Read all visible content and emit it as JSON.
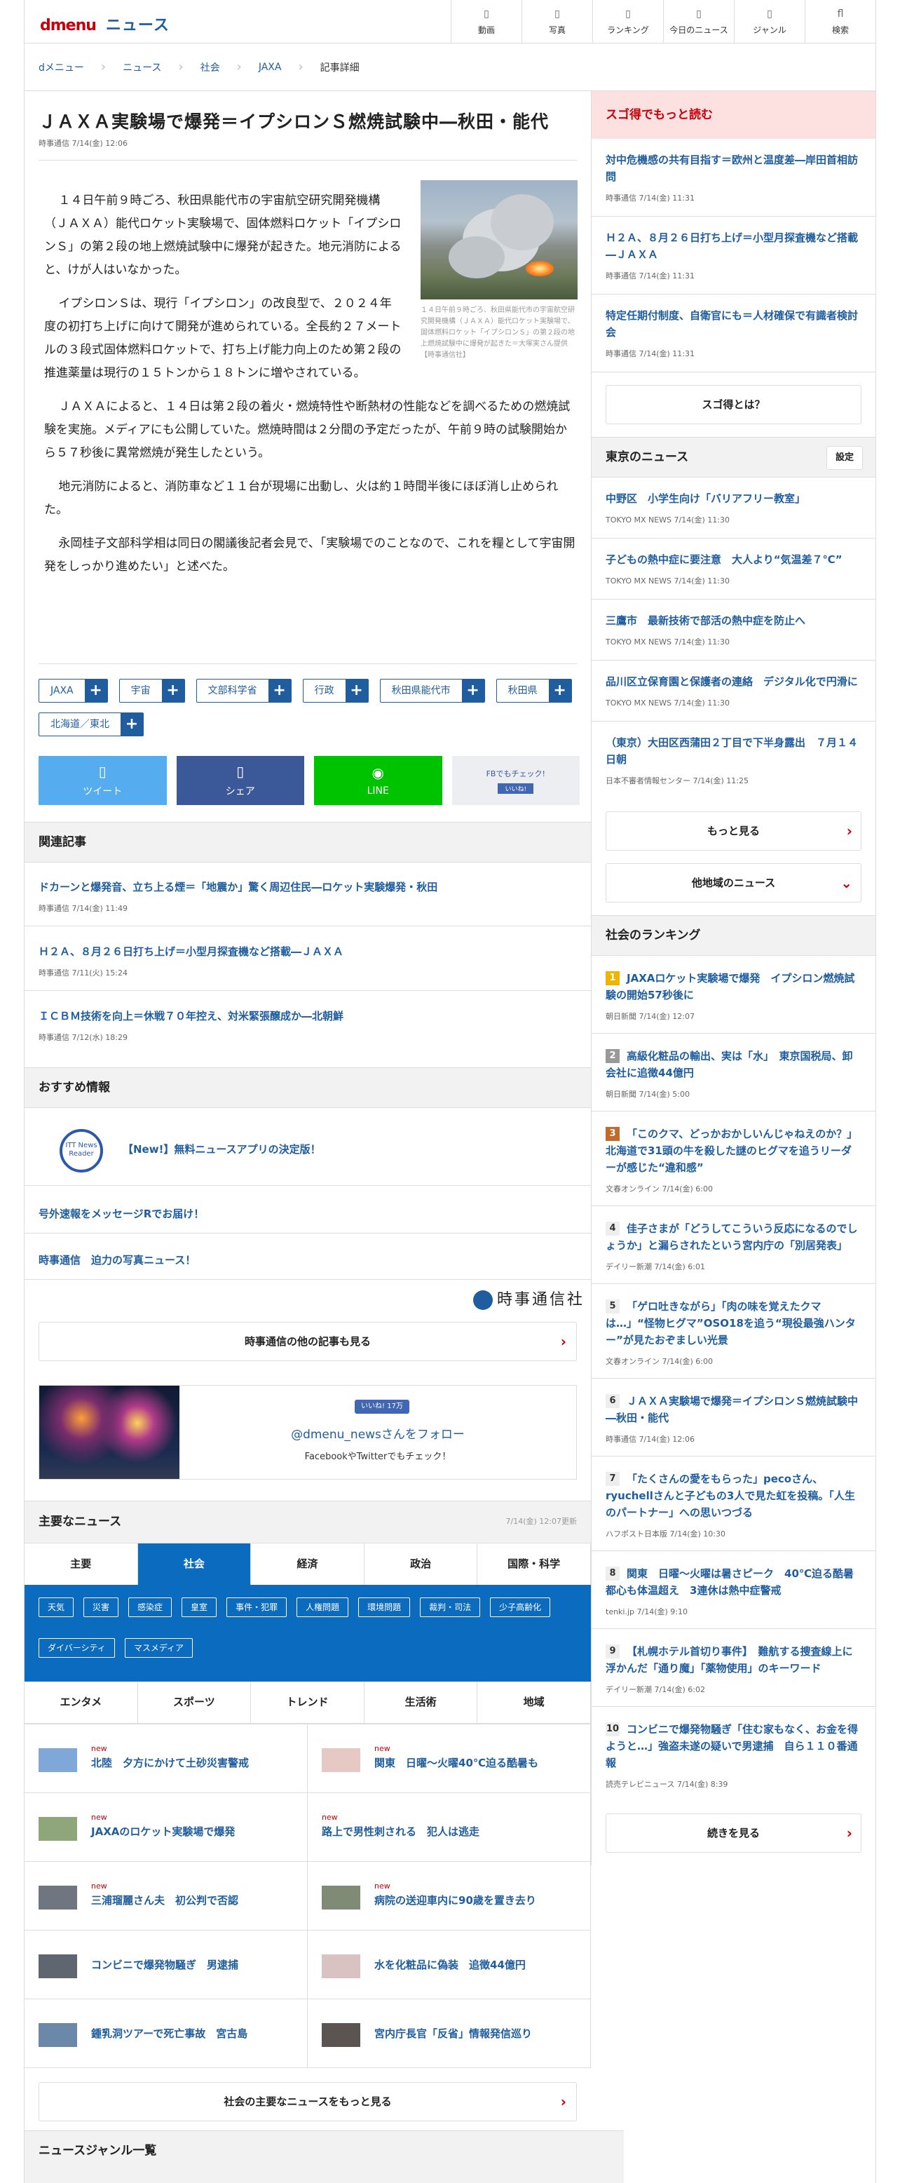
{
  "header": {
    "logo": "dmenu",
    "section": "ニュース",
    "nav": [
      {
        "icon": "video-icon",
        "label": "動画"
      },
      {
        "icon": "photo-icon",
        "label": "写真"
      },
      {
        "icon": "ranking-icon",
        "label": "ランキング"
      },
      {
        "icon": "today-icon",
        "label": "今日のニュース"
      },
      {
        "icon": "genre-icon",
        "label": "ジャンル"
      },
      {
        "icon": "search-icon",
        "label": "検索"
      }
    ]
  },
  "breadcrumb": [
    "dメニュー",
    "ニュース",
    "社会",
    "JAXA",
    "記事詳細"
  ],
  "article": {
    "title": "ＪＡＸＡ実験場で爆発＝イプシロンＳ燃焼試験中―秋田・能代",
    "meta": "時事通信 7/14(金) 12:06",
    "paragraphs": [
      "１４日午前９時ごろ、秋田県能代市の宇宙航空研究開発機構（ＪＡＸＡ）能代ロケット実験場で、固体燃料ロケット「イプシロンＳ」の第２段の地上燃焼試験中に爆発が起きた。地元消防によると、けが人はいなかった。",
      "イプシロンＳは、現行「イプシロン」の改良型で、２０２４年度の初打ち上げに向けて開発が進められている。全長約２７メートルの３段式固体燃料ロケットで、打ち上げ能力向上のため第２段の推進薬量は現行の１５トンから１８トンに増やされている。",
      "ＪＡＸＡによると、１４日は第２段の着火・燃焼特性や断熱材の性能などを調べるための燃焼試験を実施。メディアにも公開していた。燃焼時間は２分間の予定だったが、午前９時の試験開始から５７秒後に異常燃焼が発生したという。",
      "地元消防によると、消防車など１１台が現場に出動し、火は約１時間半後にほぼ消し止められた。",
      "永岡桂子文部科学相は同日の閣議後記者会見で、「実験場でのことなので、これを糧として宇宙開発をしっかり進めたい」と述べた。"
    ],
    "photo_caption": "１４日午前９時ごろ、秋田県能代市の宇宙航空研究開発機構（ＪＡＸＡ）能代ロケット実験場で、固体燃料ロケット「イプシロンＳ」の第２段の地上燃焼試験中に爆発が起きた＝大塚実さん提供【時事通信社】",
    "tags": [
      "JAXA",
      "宇宙",
      "文部科学省",
      "行政",
      "秋田県能代市",
      "秋田県",
      "北海道／東北"
    ],
    "tag_add": "+",
    "share": {
      "twitter": "ツイート",
      "facebook": "シェア",
      "line": "LINE",
      "fb_check": "FBでもチェック!",
      "fb_like": "いいね!"
    }
  },
  "related": {
    "heading": "関連記事",
    "items": [
      {
        "title": "ドカーンと爆発音、立ち上る煙＝「地震か」驚く周辺住民―ロケット実験爆発・秋田",
        "date": "時事通信 7/14(金) 11:49"
      },
      {
        "title": "Ｈ２Ａ、８月２６日打ち上げ＝小型月探査機など搭載―ＪＡＸＡ",
        "date": "時事通信 7/11(火) 15:24"
      },
      {
        "title": "ＩＣＢＭ技術を向上＝休戦７０年控え、対米緊張醸成か―北朝鮮",
        "date": "時事通信 7/12(水) 18:29"
      }
    ]
  },
  "recommend": {
    "heading": "おすすめ情報",
    "badge": "ITT News Reader",
    "items": [
      "【New!】無料ニュースアプリの決定版！",
      "号外速報をメッセージRでお届け！",
      "時事通信　迫力の写真ニュース！"
    ]
  },
  "jiji": {
    "logo": "時事通信社",
    "more": "時事通信の他の記事も見る",
    "fb_like": "いいね! 17万",
    "account": "@dmenu_newsさんをフォロー",
    "sub": "FacebookやTwitterでもチェック！"
  },
  "major": {
    "heading": "主要なニュース",
    "updated": "7/14(金) 12:07更新",
    "tabs": [
      "主要",
      "社会",
      "経済",
      "政治",
      "国際・科学"
    ],
    "active_tab": "社会",
    "pills": [
      "天気",
      "災害",
      "感染症",
      "皇室",
      "事件・犯罪",
      "人権問題",
      "環境問題",
      "裁判・司法",
      "少子高齢化",
      "ダイバーシティ",
      "マスメディア"
    ],
    "tabs2": [
      "エンタメ",
      "スポーツ",
      "トレンド",
      "生活術",
      "地域"
    ],
    "items": [
      {
        "new": "new",
        "title": "北陸　夕方にかけて土砂災害警戒"
      },
      {
        "new": "new",
        "title": "関東　日曜～火曜40℃迫る酷暑も"
      },
      {
        "new": "new",
        "title": "JAXAのロケット実験場で爆発"
      },
      {
        "new": "new",
        "title": "路上で男性刺される　犯人は逃走"
      },
      {
        "new": "new",
        "title": "三浦瑠麗さん夫　初公判で否認"
      },
      {
        "new": "new",
        "title": "病院の送迎車内に90歳を置き去り"
      },
      {
        "new": "",
        "title": "コンビニで爆発物騒ぎ　男逮捕"
      },
      {
        "new": "",
        "title": "水を化粧品に偽装　追徴44億円"
      },
      {
        "new": "",
        "title": "鍾乳洞ツアーで死亡事故　宮古島"
      },
      {
        "new": "",
        "title": "宮内庁長官「反省」情報発信巡り"
      }
    ],
    "more": "社会の主要なニュースをもっと見る"
  },
  "genre_heading": "ニュースジャンル一覧",
  "side": {
    "sugotoku": {
      "heading": "スゴ得でもっと読む",
      "items": [
        {
          "title": "対中危機感の共有目指す＝欧州と温度差―岸田首相訪問",
          "date": "時事通信 7/14(金) 11:31"
        },
        {
          "title": "Ｈ２Ａ、８月２６日打ち上げ＝小型月探査機など搭載―ＪＡＸＡ",
          "date": "時事通信 7/14(金) 11:31"
        },
        {
          "title": "特定任期付制度、自衛官にも＝人材確保で有識者検討会",
          "date": "時事通信 7/14(金) 11:31"
        }
      ],
      "button": "スゴ得とは？"
    },
    "tokyo": {
      "heading": "東京のニュース",
      "setting": "設定",
      "items": [
        {
          "title": "中野区　小学生向け「バリアフリー教室」",
          "date": "TOKYO MX NEWS 7/14(金) 11:30"
        },
        {
          "title": "子どもの熱中症に要注意　大人より“気温差７℃”",
          "date": "TOKYO MX NEWS 7/14(金) 11:30"
        },
        {
          "title": "三鷹市　最新技術で部活の熱中症を防止へ",
          "date": "TOKYO MX NEWS 7/14(金) 11:30"
        },
        {
          "title": "品川区立保育園と保護者の連絡　デジタル化で円滑に",
          "date": "TOKYO MX NEWS 7/14(金) 11:30"
        },
        {
          "title": "（東京）大田区西蒲田２丁目で下半身露出　７月１４日朝",
          "date": "日本不審者情報センター 7/14(金) 11:25"
        }
      ],
      "more": "もっと見る",
      "other": "他地域のニュース"
    },
    "ranking": {
      "heading": "社会のランキング",
      "items": [
        {
          "n": "1",
          "title": "JAXAロケット実験場で爆発　イプシロン燃焼試験の開始57秒後に",
          "date": "朝日新聞 7/14(金) 12:07"
        },
        {
          "n": "2",
          "title": "高級化粧品の輸出、実は「水」　東京国税局、卸会社に追徴44億円",
          "date": "朝日新聞 7/14(金) 5:00"
        },
        {
          "n": "3",
          "title": "「このクマ、どっかおかしいんじゃねえのか？」北海道で31頭の牛を殺した謎のヒグマを追うリーダーが感じた“違和感”",
          "date": "文春オンライン 7/14(金) 6:00"
        },
        {
          "n": "4",
          "title": "佳子さまが「どうしてこういう反応になるのでしょうか」と漏らされたという宮内庁の「別居発表」",
          "date": "デイリー新潮 7/14(金) 6:01"
        },
        {
          "n": "5",
          "title": "「ゲロ吐きながら」「肉の味を覚えたクマは…」“怪物ヒグマ”OSO18を追う“現役最強ハンター”が見たおぞましい光景",
          "date": "文春オンライン 7/14(金) 6:00"
        },
        {
          "n": "6",
          "title": "ＪＡＸＡ実験場で爆発＝イプシロンＳ燃焼試験中―秋田・能代",
          "date": "時事通信 7/14(金) 12:06"
        },
        {
          "n": "7",
          "title": "「たくさんの愛をもらった」pecoさん、ryuchellさんと子どもの3人で見た虹を投稿。「人生のパートナー」への思いつづる",
          "date": "ハフポスト日本版 7/14(金) 10:30"
        },
        {
          "n": "8",
          "title": "関東　日曜～火曜は暑さピーク　40℃迫る酷暑　都心も体温超え　3連休は熱中症警戒",
          "date": "tenki.jp 7/14(金) 9:10"
        },
        {
          "n": "9",
          "title": "【札幌ホテル首切り事件】　難航する捜査線上に浮かんだ「通り魔」「薬物使用」のキーワード",
          "date": "デイリー新潮 7/14(金) 6:02"
        },
        {
          "n": "10",
          "title": "コンビニで爆発物騒ぎ「住む家もなく、お金を得ようと…」強盗未遂の疑いで男逮捕　自ら１１０番通報",
          "date": "読売テレビニュース 7/14(金) 8:39"
        }
      ],
      "more": "続きを見る"
    }
  }
}
